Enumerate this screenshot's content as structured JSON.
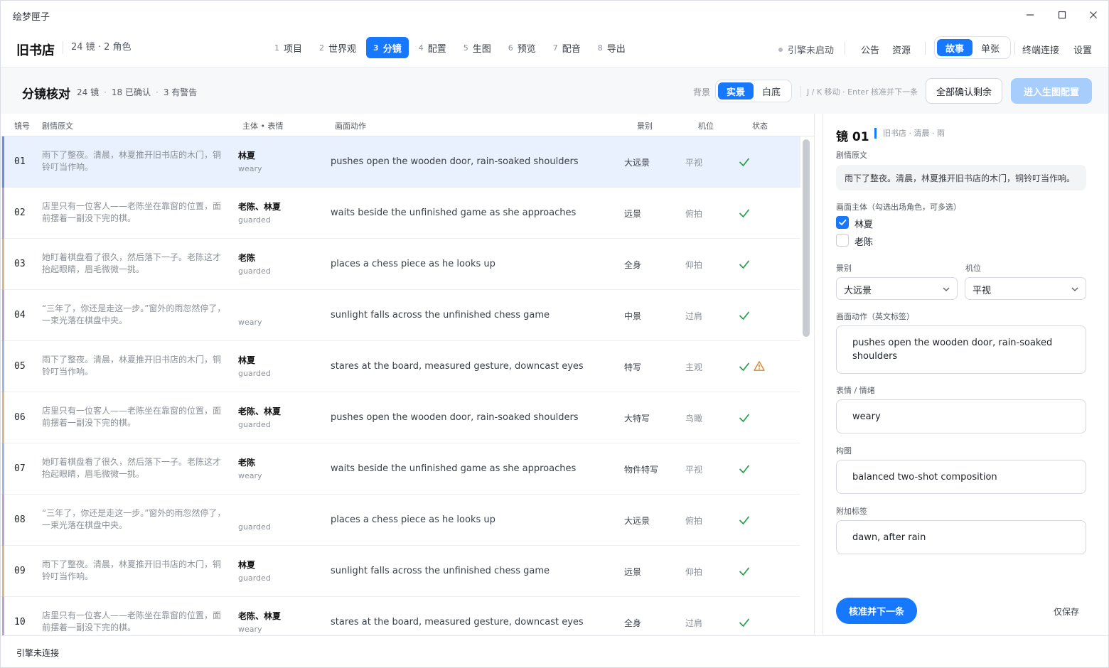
{
  "window": {
    "title": "绘梦匣子"
  },
  "header": {
    "project_name": "旧书店",
    "project_meta": "24 镜 · 2 角色",
    "steps": [
      {
        "n": "1",
        "label": "项目"
      },
      {
        "n": "2",
        "label": "世界观"
      },
      {
        "n": "3",
        "label": "分镜"
      },
      {
        "n": "4",
        "label": "配置"
      },
      {
        "n": "5",
        "label": "生图"
      },
      {
        "n": "6",
        "label": "预览"
      },
      {
        "n": "7",
        "label": "配音"
      },
      {
        "n": "8",
        "label": "导出"
      }
    ],
    "active_step": "3",
    "engine_status": "引擎未启动",
    "announcement": "公告",
    "resources": "资源",
    "mode_options": [
      "故事",
      "单张"
    ],
    "mode_selected": "故事",
    "terminal": "终端连接",
    "settings": "设置"
  },
  "toolbar": {
    "title": "分镜核对",
    "stats": [
      "24 镜",
      "18 已确认",
      "3 有警告"
    ],
    "stats_sep": "·",
    "bg_label": "背景",
    "bg_options": [
      "实景",
      "白底"
    ],
    "bg_selected": "实景",
    "kb_hint": "J / K 移动 · Enter 核准并下一条",
    "confirm_all": "全部确认剩余",
    "next_stage": "进入生图配置"
  },
  "table": {
    "columns": [
      "镜号",
      "剧情原文",
      "主体 • 表情",
      "画面动作",
      "景别",
      "机位",
      "状态"
    ],
    "rows": [
      {
        "num": "01",
        "story": "雨下了整夜。清晨，林夏推开旧书店的木门，铜铃叮当作响。",
        "subject": "林夏",
        "expression": "weary",
        "action": "pushes open the wooden door, rain-soaked shoulders",
        "shot": "大远景",
        "angle": "平视",
        "status": "ok",
        "warning": false,
        "color": "#6d8fd8",
        "selected": true
      },
      {
        "num": "02",
        "story": "店里只有一位客人——老陈坐在靠窗的位置，面前摆着一副没下完的棋。",
        "subject": "老陈、林夏",
        "expression": "guarded",
        "action": "waits beside the unfinished game as she approaches",
        "shot": "远景",
        "angle": "俯拍",
        "status": "ok",
        "warning": false,
        "color": "#b9a3d9",
        "selected": false
      },
      {
        "num": "03",
        "story": "她盯着棋盘看了很久，然后落下一子。老陈这才抬起眼睛，眉毛微微一挑。",
        "subject": "老陈",
        "expression": "guarded",
        "action": "places a chess piece as he looks up",
        "shot": "全身",
        "angle": "仰拍",
        "status": "ok",
        "warning": false,
        "color": "#d9b88a",
        "selected": false
      },
      {
        "num": "04",
        "story": "“三年了，你还是走这一步。”窗外的雨忽然停了，一束光落在棋盘中央。",
        "subject": "",
        "expression": "weary",
        "action": "sunlight falls across the unfinished chess game",
        "shot": "中景",
        "angle": "过肩",
        "status": "ok",
        "warning": false,
        "color": "#b9a3d9",
        "selected": false
      },
      {
        "num": "05",
        "story": "雨下了整夜。清晨，林夏推开旧书店的木门，铜铃叮当作响。",
        "subject": "林夏",
        "expression": "guarded",
        "action": "stares at the board, measured gesture, downcast eyes",
        "shot": "特写",
        "angle": "主观",
        "status": "ok",
        "warning": true,
        "color": "#9db8e6",
        "selected": false
      },
      {
        "num": "06",
        "story": "店里只有一位客人——老陈坐在靠窗的位置，面前摆着一副没下完的棋。",
        "subject": "老陈、林夏",
        "expression": "guarded",
        "action": "pushes open the wooden door, rain-soaked shoulders",
        "shot": "大特写",
        "angle": "鸟瞰",
        "status": "ok",
        "warning": false,
        "color": "#d9b88a",
        "selected": false
      },
      {
        "num": "07",
        "story": "她盯着棋盘看了很久，然后落下一子。老陈这才抬起眼睛，眉毛微微一挑。",
        "subject": "老陈",
        "expression": "weary",
        "action": "waits beside the unfinished game as she approaches",
        "shot": "物件特写",
        "angle": "平视",
        "status": "ok",
        "warning": false,
        "color": "#9db8e6",
        "selected": false
      },
      {
        "num": "08",
        "story": "“三年了，你还是走这一步。”窗外的雨忽然停了，一束光落在棋盘中央。",
        "subject": "",
        "expression": "guarded",
        "action": "places a chess piece as he looks up",
        "shot": "大远景",
        "angle": "俯拍",
        "status": "ok",
        "warning": false,
        "color": "#b9a3d9",
        "selected": false
      },
      {
        "num": "09",
        "story": "雨下了整夜。清晨，林夏推开旧书店的木门，铜铃叮当作响。",
        "subject": "林夏",
        "expression": "guarded",
        "action": "sunlight falls across the unfinished chess game",
        "shot": "远景",
        "angle": "仰拍",
        "status": "ok",
        "warning": false,
        "color": "#d9b88a",
        "selected": false
      },
      {
        "num": "10",
        "story": "店里只有一位客人——老陈坐在靠窗的位置，面前摆着一副没下完的棋。",
        "subject": "老陈、林夏",
        "expression": "weary",
        "action": "stares at the board, measured gesture, downcast eyes",
        "shot": "全身",
        "angle": "过肩",
        "status": "ok",
        "warning": false,
        "color": "#b9a3d9",
        "selected": false
      }
    ]
  },
  "panel": {
    "shot_title": "镜 01",
    "shot_meta": "旧书店 · 清晨 · 雨",
    "story_label": "剧情原文",
    "story_text": "雨下了整夜。清晨，林夏推开旧书店的木门，铜铃叮当作响。",
    "subject_label": "画面主体（勾选出场角色，可多选）",
    "characters": [
      {
        "name": "林夏",
        "checked": true
      },
      {
        "name": "老陈",
        "checked": false
      }
    ],
    "shot_label": "景别",
    "shot_value": "大远景",
    "angle_label": "机位",
    "angle_value": "平视",
    "action_label": "画面动作（英文标签）",
    "action_value": "pushes open the wooden door, rain-soaked shoulders",
    "emotion_label": "表情 / 情绪",
    "emotion_value": "weary",
    "composition_label": "构图",
    "composition_value": "balanced two-shot composition",
    "tags_label": "附加标签",
    "tags_value": "dawn, after rain",
    "approve_next": "核准并下一条",
    "save_only": "仅保存"
  },
  "statusbar": {
    "text": "引擎未连接"
  },
  "colors": {
    "accent": "#1677ff",
    "ok": "#2e9e4f",
    "warn": "#d9822b",
    "selected_row": "#e8f1fd"
  }
}
